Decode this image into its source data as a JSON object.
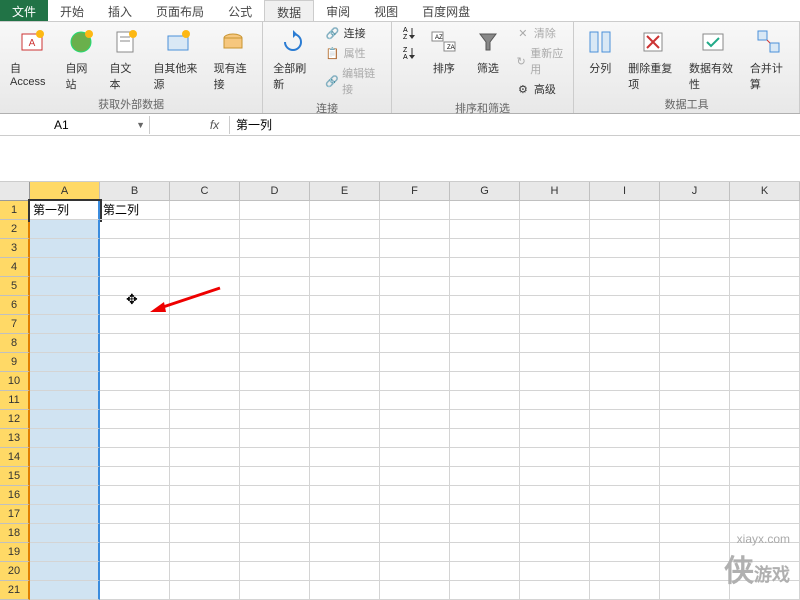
{
  "tabs": {
    "file": "文件",
    "items": [
      "开始",
      "插入",
      "页面布局",
      "公式",
      "数据",
      "审阅",
      "视图",
      "百度网盘"
    ],
    "active_index": 4
  },
  "ribbon": {
    "group_external": {
      "label": "获取外部数据",
      "access": "自 Access",
      "web": "自网站",
      "text": "自文本",
      "other": "自其他来源",
      "existing": "现有连接"
    },
    "group_conn": {
      "label": "连接",
      "refresh": "全部刷新",
      "connections": "连接",
      "properties": "属性",
      "editlinks": "编辑链接"
    },
    "group_sort": {
      "label": "排序和筛选",
      "sort": "排序",
      "filter": "筛选",
      "clear": "清除",
      "reapply": "重新应用",
      "advanced": "高级"
    },
    "group_tools": {
      "label": "数据工具",
      "textcol": "分列",
      "dedup": "删除重复项",
      "validation": "数据有效性",
      "consolidate": "合并计算"
    }
  },
  "formula": {
    "namebox": "A1",
    "fx": "fx",
    "value": "第一列"
  },
  "grid": {
    "cols": [
      "A",
      "B",
      "C",
      "D",
      "E",
      "F",
      "G",
      "H",
      "I",
      "J",
      "K"
    ],
    "rows": [
      "1",
      "2",
      "3",
      "4",
      "5",
      "6",
      "7",
      "8",
      "9",
      "10",
      "11",
      "12",
      "13",
      "14",
      "15",
      "16",
      "17",
      "18",
      "19",
      "20",
      "21"
    ],
    "A1": "第一列",
    "B1": "第二列"
  },
  "watermark": {
    "site": "xiayx.com",
    "brand": "侠",
    "sub": "游戏"
  }
}
